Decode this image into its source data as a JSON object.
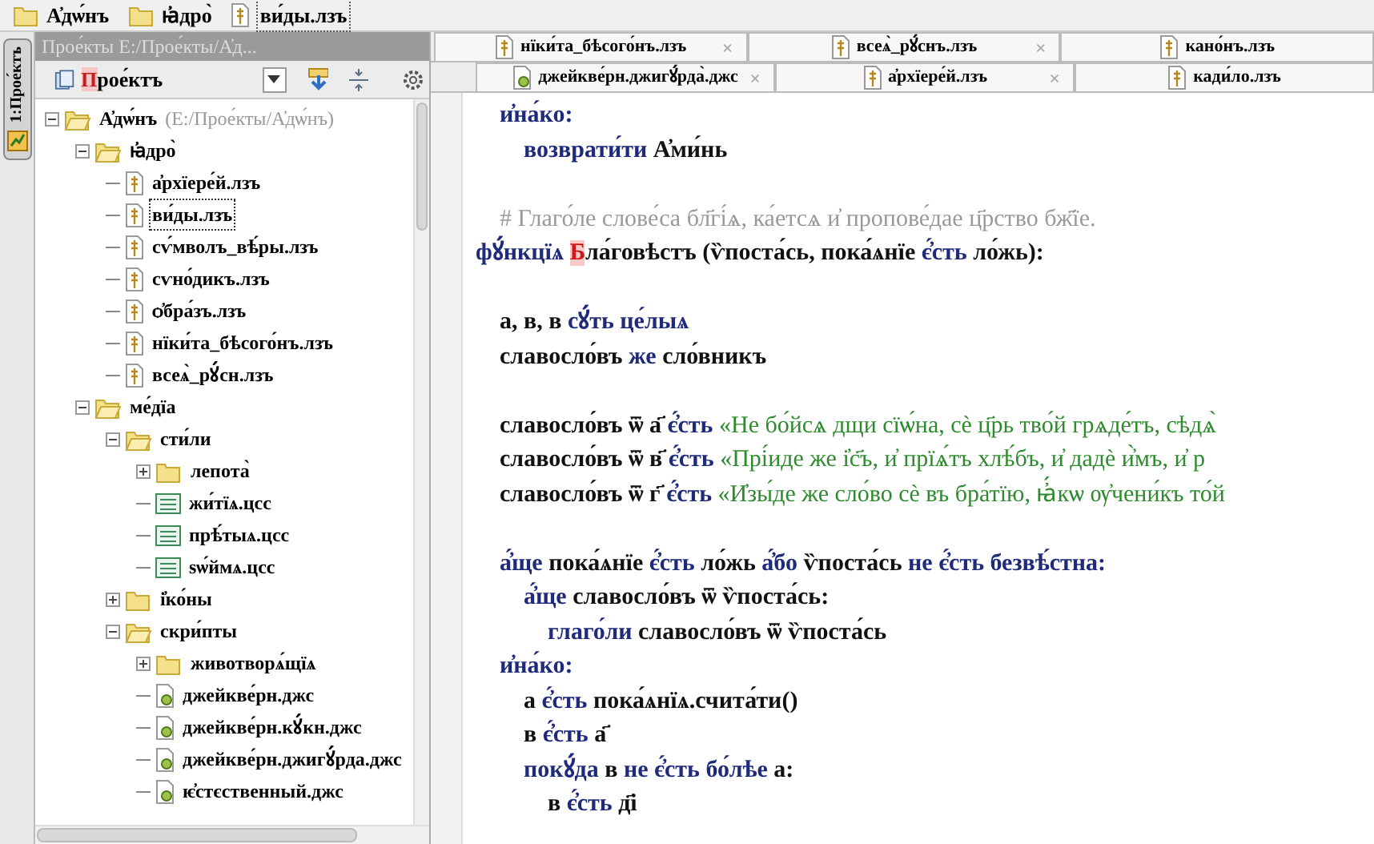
{
  "breadcrumb": [
    {
      "label": "А҆дѡ́нъ",
      "kind": "folder"
    },
    {
      "label": "ꙗ҆дро̀",
      "kind": "folder"
    },
    {
      "label": "ви́ды.лзъ",
      "kind": "file"
    }
  ],
  "side_tab": {
    "label": "1:Прое́ктъ"
  },
  "panel": {
    "title": "Прое́кты  Е:/Прое́кты/А҆д...",
    "view_label": "Прое́ктъ"
  },
  "tree": [
    {
      "label": "А҆дѡ́нъ",
      "path": "(Е:/Прое́кты/А҆дѡ́нъ)",
      "kind": "folder",
      "expanded": true,
      "selected": false,
      "children": [
        {
          "label": "ꙗ҆дро̀",
          "kind": "folder",
          "expanded": true,
          "selected": false,
          "children": [
            {
              "label": "а҆рхїере́й.лзъ",
              "kind": "file",
              "selected": false
            },
            {
              "label": "ви́ды.лзъ",
              "kind": "file",
              "selected": true
            },
            {
              "label": "сѵ́мволъ_вѣ́ры.лзъ",
              "kind": "file",
              "selected": false
            },
            {
              "label": "сѵно́дикъ.лзъ",
              "kind": "file",
              "selected": false
            },
            {
              "label": "ѻ҆бра́зъ.лзъ",
              "kind": "file",
              "selected": false
            },
            {
              "label": "нїки́та_бѣсого́нъ.лзъ",
              "kind": "file",
              "selected": false
            },
            {
              "label": "всеѧ̀_рꙋ́сн.лзъ",
              "kind": "file",
              "selected": false
            }
          ]
        },
        {
          "label": "ме́дїа",
          "kind": "folder",
          "expanded": true,
          "selected": false,
          "children": [
            {
              "label": "сти́ли",
              "kind": "folder",
              "expanded": true,
              "selected": false,
              "children": [
                {
                  "label": "лепота̀",
                  "kind": "folder",
                  "expanded": false,
                  "selected": false
                },
                {
                  "label": "жи́тїѧ.цсс",
                  "kind": "css",
                  "selected": false
                },
                {
                  "label": "прѣ́тыѧ.цсс",
                  "kind": "css",
                  "selected": false
                },
                {
                  "label": "ѕѡ́ймѧ.цсс",
                  "kind": "css",
                  "selected": false
                }
              ]
            },
            {
              "label": "і҆ко́ны",
              "kind": "folder",
              "expanded": false,
              "selected": false
            },
            {
              "label": "скри́пты",
              "kind": "folder",
              "expanded": true,
              "selected": false,
              "children": [
                {
                  "label": "животворѧ́щїѧ",
                  "kind": "folder",
                  "expanded": false,
                  "selected": false
                },
                {
                  "label": "джейкве́рн.джс",
                  "kind": "js",
                  "selected": false
                },
                {
                  "label": "джейкве́рн.кꙋ́кн.джс",
                  "kind": "js",
                  "selected": false
                },
                {
                  "label": "джейкве́рн.джигꙋ́рда.джс",
                  "kind": "js",
                  "selected": false
                },
                {
                  "label": "ѥ҆стєственный.джс",
                  "kind": "js",
                  "selected": false
                }
              ]
            }
          ]
        }
      ]
    }
  ],
  "tabs": [
    [
      {
        "label": "нїки́та_бѣсого́нъ.лзъ",
        "kind": "file",
        "close": "×"
      },
      {
        "label": "всеѧ̀_рꙋ́снъ.лзъ",
        "kind": "file",
        "close": "×"
      },
      {
        "label": "кано́нъ.лзъ",
        "kind": "file"
      }
    ],
    [
      {
        "label": "джейкве́рн.джигꙋ́рда̀.джс",
        "kind": "js",
        "close": "×"
      },
      {
        "label": "а҆рхїере́й.лзъ",
        "kind": "file",
        "close": "×"
      },
      {
        "label": "кади́ло.лзъ",
        "kind": "file"
      }
    ]
  ],
  "code_blocks": [
    [
      [
        {
          "text": "    и҆на́ко:",
          "kind": "keyword"
        }
      ],
      [
        {
          "text": "        возврати́ти",
          "kind": "keyword"
        },
        {
          "text": " А҆ми́нь",
          "kind": "plain"
        }
      ]
    ],
    [
      [
        {
          "text": "    # Глаго́ле слове́са бл҃гі́ѧ, ка́етсѧ и҆ пропове́дае ц҃рство бж҃їе.",
          "kind": "comment"
        }
      ],
      [
        {
          "text": "фꙋ́нкцїѧ ",
          "kind": "keyword"
        },
        {
          "text": "Б",
          "kind": "initial"
        },
        {
          "text": "ла́говѣстъ (ѷпоста́сь, пока́ѧнїе",
          "kind": "plain"
        },
        {
          "text": " є҆́сть",
          "kind": "keyword"
        },
        {
          "text": " ло́жь):",
          "kind": "plain"
        }
      ]
    ],
    [
      [
        {
          "text": "    а, в, в",
          "kind": "plain"
        },
        {
          "text": " сꙋ́ть це́лыѧ",
          "kind": "keyword"
        }
      ],
      [
        {
          "text": "    славосло́въ",
          "kind": "plain"
        },
        {
          "text": " же",
          "kind": "keyword"
        },
        {
          "text": " сло́вникъ",
          "kind": "plain"
        }
      ]
    ],
    [
      [
        {
          "text": "    славосло́въ ѿ а҃",
          "kind": "plain"
        },
        {
          "text": " є҆́сть",
          "kind": "keyword"
        },
        {
          "text": " «Не бо́йсѧ дщи сїѡ́на, сѐ ц҃рь тво́й грѧде́тъ, сѣдѧ̀",
          "kind": "string"
        }
      ],
      [
        {
          "text": "    славосло́въ ѿ в҃",
          "kind": "plain"
        },
        {
          "text": " є҆́сть",
          "kind": "keyword"
        },
        {
          "text": " «Прі́иде же і҆с҃ъ, и҆ прїѧ́тъ хлѣ́бъ, и҆ дадѐ и҆̀мъ, и҆ р",
          "kind": "string"
        }
      ],
      [
        {
          "text": "    славосло́въ ѿ г҃",
          "kind": "plain"
        },
        {
          "text": " є҆́сть",
          "kind": "keyword"
        },
        {
          "text": " «И҆зы́де же сло́во сѐ въ бра́тїю, ꙗ҆́кѡ ѹ҆чени́къ то́й",
          "kind": "string"
        }
      ]
    ],
    [
      [
        {
          "text": "    а҆́ще",
          "kind": "keyword"
        },
        {
          "text": " пока́ѧнїе",
          "kind": "plain"
        },
        {
          "text": " є҆́сть",
          "kind": "keyword"
        },
        {
          "text": " ло́жь",
          "kind": "plain"
        },
        {
          "text": " а҆́бо",
          "kind": "keyword"
        },
        {
          "text": " ѷпоста́сь",
          "kind": "plain"
        },
        {
          "text": " не є҆́сть безвѣ́стна:",
          "kind": "keyword"
        }
      ],
      [
        {
          "text": "        а҆́ще",
          "kind": "keyword"
        },
        {
          "text": " славосло́въ ѿ ѷпоста́сь:",
          "kind": "plain"
        }
      ],
      [
        {
          "text": "            глаго́ли",
          "kind": "keyword"
        },
        {
          "text": " славосло́въ ѿ ѷпоста́сь",
          "kind": "plain"
        }
      ],
      [
        {
          "text": "    и҆на́ко:",
          "kind": "keyword"
        }
      ],
      [
        {
          "text": "        а",
          "kind": "plain"
        },
        {
          "text": " є҆́сть",
          "kind": "keyword"
        },
        {
          "text": " пока́ѧнїѧ.счита́ти()",
          "kind": "plain"
        }
      ],
      [
        {
          "text": "        в",
          "kind": "plain"
        },
        {
          "text": " є҆́сть",
          "kind": "keyword"
        },
        {
          "text": " а҃",
          "kind": "plain"
        }
      ],
      [
        {
          "text": "        покꙋ́да",
          "kind": "keyword"
        },
        {
          "text": " в",
          "kind": "plain"
        },
        {
          "text": " не є҆́сть бо́лѣе",
          "kind": "keyword"
        },
        {
          "text": " а:",
          "kind": "plain"
        }
      ],
      [
        {
          "text": "            в",
          "kind": "plain"
        },
        {
          "text": " є҆́сть",
          "kind": "keyword"
        },
        {
          "text": " д҃і",
          "kind": "plain"
        }
      ]
    ]
  ]
}
